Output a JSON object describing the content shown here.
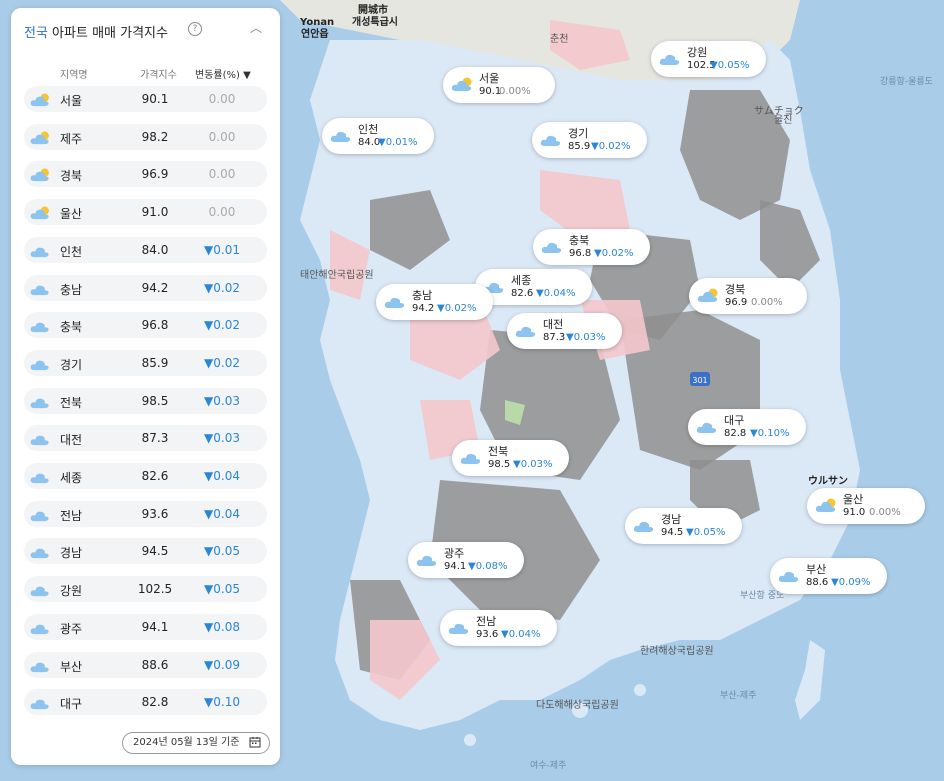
{
  "panel": {
    "title_accent": "전국",
    "title_rest": " 아파트 매매 가격지수",
    "help_icon": "?",
    "collapse_icon": "︿",
    "headers": {
      "region": "지역명",
      "index": "가격지수",
      "change": "변동률(%) ▼"
    },
    "rows": [
      {
        "region": "서울",
        "index": "90.1",
        "change": "0.00",
        "weather": "partly-sunny"
      },
      {
        "region": "제주",
        "index": "98.2",
        "change": "0.00",
        "weather": "partly-sunny"
      },
      {
        "region": "경북",
        "index": "96.9",
        "change": "0.00",
        "weather": "partly-sunny"
      },
      {
        "region": "울산",
        "index": "91.0",
        "change": "0.00",
        "weather": "partly-sunny"
      },
      {
        "region": "인천",
        "index": "84.0",
        "change": "▼0.01",
        "weather": "cloudy"
      },
      {
        "region": "충남",
        "index": "94.2",
        "change": "▼0.02",
        "weather": "cloudy"
      },
      {
        "region": "충북",
        "index": "96.8",
        "change": "▼0.02",
        "weather": "cloudy"
      },
      {
        "region": "경기",
        "index": "85.9",
        "change": "▼0.02",
        "weather": "cloudy"
      },
      {
        "region": "전북",
        "index": "98.5",
        "change": "▼0.03",
        "weather": "cloudy"
      },
      {
        "region": "대전",
        "index": "87.3",
        "change": "▼0.03",
        "weather": "cloudy"
      },
      {
        "region": "세종",
        "index": "82.6",
        "change": "▼0.04",
        "weather": "cloudy"
      },
      {
        "region": "전남",
        "index": "93.6",
        "change": "▼0.04",
        "weather": "cloudy"
      },
      {
        "region": "경남",
        "index": "94.5",
        "change": "▼0.05",
        "weather": "cloudy"
      },
      {
        "region": "강원",
        "index": "102.5",
        "change": "▼0.05",
        "weather": "cloudy"
      },
      {
        "region": "광주",
        "index": "94.1",
        "change": "▼0.08",
        "weather": "cloudy"
      },
      {
        "region": "부산",
        "index": "88.6",
        "change": "▼0.09",
        "weather": "cloudy"
      },
      {
        "region": "대구",
        "index": "82.8",
        "change": "▼0.10",
        "weather": "cloudy"
      }
    ],
    "date": "2024년 05월 13일 기준",
    "calendar_icon": "calendar-icon"
  },
  "map_pins": [
    {
      "region": "서울",
      "index": "90.1",
      "change": "0.00%",
      "weather": "partly-sunny"
    },
    {
      "region": "강원",
      "index": "102.5",
      "change": "▼0.05%",
      "weather": "cloudy"
    },
    {
      "region": "인천",
      "index": "84.0",
      "change": "▼0.01%",
      "weather": "cloudy"
    },
    {
      "region": "경기",
      "index": "85.9",
      "change": "▼0.02%",
      "weather": "cloudy"
    },
    {
      "region": "충북",
      "index": "96.8",
      "change": "▼0.02%",
      "weather": "cloudy"
    },
    {
      "region": "세종",
      "index": "82.6",
      "change": "▼0.04%",
      "weather": "cloudy"
    },
    {
      "region": "충남",
      "index": "94.2",
      "change": "▼0.02%",
      "weather": "cloudy"
    },
    {
      "region": "경북",
      "index": "96.9",
      "change": "0.00%",
      "weather": "partly-sunny"
    },
    {
      "region": "대전",
      "index": "87.3",
      "change": "▼0.03%",
      "weather": "cloudy"
    },
    {
      "region": "대구",
      "index": "82.8",
      "change": "▼0.10%",
      "weather": "cloudy"
    },
    {
      "region": "전북",
      "index": "98.5",
      "change": "▼0.03%",
      "weather": "cloudy"
    },
    {
      "region": "울산",
      "index": "91.0",
      "change": "0.00%",
      "weather": "partly-sunny"
    },
    {
      "region": "경남",
      "index": "94.5",
      "change": "▼0.05%",
      "weather": "cloudy"
    },
    {
      "region": "광주",
      "index": "94.1",
      "change": "▼0.08%",
      "weather": "cloudy"
    },
    {
      "region": "부산",
      "index": "88.6",
      "change": "▼0.09%",
      "weather": "cloudy"
    },
    {
      "region": "전남",
      "index": "93.6",
      "change": "▼0.04%",
      "weather": "cloudy"
    }
  ],
  "map_labels": {
    "kaesong": "開城市",
    "kaesong_kr": "개성특급시",
    "yonan": "Yonan",
    "yonan_kr": "연안읍",
    "chuncheon": "춘천",
    "samcheok": "サムチョク",
    "ulsan": "ウルサン",
    "uljin": "울진",
    "gangneung": "강릉항-울릉도",
    "ferry1": "여수-제주",
    "ferry2": "부산-제주",
    "busan_sea": "부산항 중도",
    "dadohae": "다도해해상국립공원",
    "hallyeo": "한려해상국립공원",
    "taean": "태안해안국립공원"
  },
  "colors": {
    "accent": "#2f6fd8",
    "decrease": "#2a86d6",
    "sea": "#a9cde9",
    "land_grey": "#8f8f8f",
    "land_blue": "#dbe9f7",
    "land_pink": "#f4c8cc"
  }
}
